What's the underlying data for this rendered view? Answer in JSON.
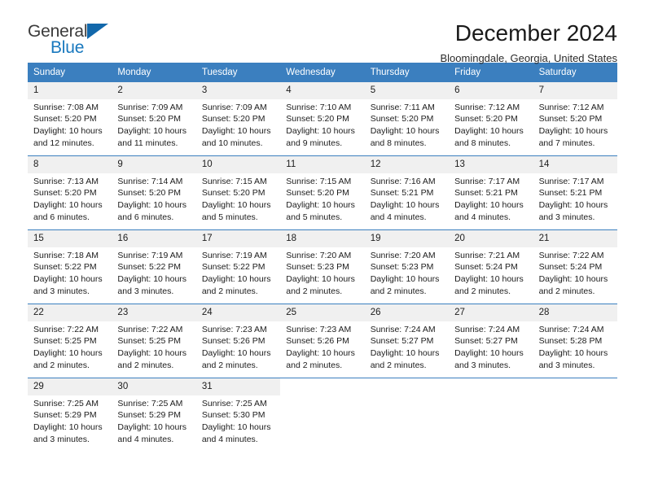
{
  "brand": {
    "name_part1": "General",
    "name_part2": "Blue",
    "triangle_icon": "triangle-icon",
    "accent_color": "#1878be"
  },
  "header": {
    "title": "December 2024",
    "location": "Bloomingdale, Georgia, United States"
  },
  "calendar": {
    "header_color": "#3b7fbf",
    "weekdays": [
      "Sunday",
      "Monday",
      "Tuesday",
      "Wednesday",
      "Thursday",
      "Friday",
      "Saturday"
    ],
    "weeks": [
      [
        {
          "day": "1",
          "sunrise": "Sunrise: 7:08 AM",
          "sunset": "Sunset: 5:20 PM",
          "daylight": "Daylight: 10 hours and 12 minutes."
        },
        {
          "day": "2",
          "sunrise": "Sunrise: 7:09 AM",
          "sunset": "Sunset: 5:20 PM",
          "daylight": "Daylight: 10 hours and 11 minutes."
        },
        {
          "day": "3",
          "sunrise": "Sunrise: 7:09 AM",
          "sunset": "Sunset: 5:20 PM",
          "daylight": "Daylight: 10 hours and 10 minutes."
        },
        {
          "day": "4",
          "sunrise": "Sunrise: 7:10 AM",
          "sunset": "Sunset: 5:20 PM",
          "daylight": "Daylight: 10 hours and 9 minutes."
        },
        {
          "day": "5",
          "sunrise": "Sunrise: 7:11 AM",
          "sunset": "Sunset: 5:20 PM",
          "daylight": "Daylight: 10 hours and 8 minutes."
        },
        {
          "day": "6",
          "sunrise": "Sunrise: 7:12 AM",
          "sunset": "Sunset: 5:20 PM",
          "daylight": "Daylight: 10 hours and 8 minutes."
        },
        {
          "day": "7",
          "sunrise": "Sunrise: 7:12 AM",
          "sunset": "Sunset: 5:20 PM",
          "daylight": "Daylight: 10 hours and 7 minutes."
        }
      ],
      [
        {
          "day": "8",
          "sunrise": "Sunrise: 7:13 AM",
          "sunset": "Sunset: 5:20 PM",
          "daylight": "Daylight: 10 hours and 6 minutes."
        },
        {
          "day": "9",
          "sunrise": "Sunrise: 7:14 AM",
          "sunset": "Sunset: 5:20 PM",
          "daylight": "Daylight: 10 hours and 6 minutes."
        },
        {
          "day": "10",
          "sunrise": "Sunrise: 7:15 AM",
          "sunset": "Sunset: 5:20 PM",
          "daylight": "Daylight: 10 hours and 5 minutes."
        },
        {
          "day": "11",
          "sunrise": "Sunrise: 7:15 AM",
          "sunset": "Sunset: 5:20 PM",
          "daylight": "Daylight: 10 hours and 5 minutes."
        },
        {
          "day": "12",
          "sunrise": "Sunrise: 7:16 AM",
          "sunset": "Sunset: 5:21 PM",
          "daylight": "Daylight: 10 hours and 4 minutes."
        },
        {
          "day": "13",
          "sunrise": "Sunrise: 7:17 AM",
          "sunset": "Sunset: 5:21 PM",
          "daylight": "Daylight: 10 hours and 4 minutes."
        },
        {
          "day": "14",
          "sunrise": "Sunrise: 7:17 AM",
          "sunset": "Sunset: 5:21 PM",
          "daylight": "Daylight: 10 hours and 3 minutes."
        }
      ],
      [
        {
          "day": "15",
          "sunrise": "Sunrise: 7:18 AM",
          "sunset": "Sunset: 5:22 PM",
          "daylight": "Daylight: 10 hours and 3 minutes."
        },
        {
          "day": "16",
          "sunrise": "Sunrise: 7:19 AM",
          "sunset": "Sunset: 5:22 PM",
          "daylight": "Daylight: 10 hours and 3 minutes."
        },
        {
          "day": "17",
          "sunrise": "Sunrise: 7:19 AM",
          "sunset": "Sunset: 5:22 PM",
          "daylight": "Daylight: 10 hours and 2 minutes."
        },
        {
          "day": "18",
          "sunrise": "Sunrise: 7:20 AM",
          "sunset": "Sunset: 5:23 PM",
          "daylight": "Daylight: 10 hours and 2 minutes."
        },
        {
          "day": "19",
          "sunrise": "Sunrise: 7:20 AM",
          "sunset": "Sunset: 5:23 PM",
          "daylight": "Daylight: 10 hours and 2 minutes."
        },
        {
          "day": "20",
          "sunrise": "Sunrise: 7:21 AM",
          "sunset": "Sunset: 5:24 PM",
          "daylight": "Daylight: 10 hours and 2 minutes."
        },
        {
          "day": "21",
          "sunrise": "Sunrise: 7:22 AM",
          "sunset": "Sunset: 5:24 PM",
          "daylight": "Daylight: 10 hours and 2 minutes."
        }
      ],
      [
        {
          "day": "22",
          "sunrise": "Sunrise: 7:22 AM",
          "sunset": "Sunset: 5:25 PM",
          "daylight": "Daylight: 10 hours and 2 minutes."
        },
        {
          "day": "23",
          "sunrise": "Sunrise: 7:22 AM",
          "sunset": "Sunset: 5:25 PM",
          "daylight": "Daylight: 10 hours and 2 minutes."
        },
        {
          "day": "24",
          "sunrise": "Sunrise: 7:23 AM",
          "sunset": "Sunset: 5:26 PM",
          "daylight": "Daylight: 10 hours and 2 minutes."
        },
        {
          "day": "25",
          "sunrise": "Sunrise: 7:23 AM",
          "sunset": "Sunset: 5:26 PM",
          "daylight": "Daylight: 10 hours and 2 minutes."
        },
        {
          "day": "26",
          "sunrise": "Sunrise: 7:24 AM",
          "sunset": "Sunset: 5:27 PM",
          "daylight": "Daylight: 10 hours and 2 minutes."
        },
        {
          "day": "27",
          "sunrise": "Sunrise: 7:24 AM",
          "sunset": "Sunset: 5:27 PM",
          "daylight": "Daylight: 10 hours and 3 minutes."
        },
        {
          "day": "28",
          "sunrise": "Sunrise: 7:24 AM",
          "sunset": "Sunset: 5:28 PM",
          "daylight": "Daylight: 10 hours and 3 minutes."
        }
      ],
      [
        {
          "day": "29",
          "sunrise": "Sunrise: 7:25 AM",
          "sunset": "Sunset: 5:29 PM",
          "daylight": "Daylight: 10 hours and 3 minutes."
        },
        {
          "day": "30",
          "sunrise": "Sunrise: 7:25 AM",
          "sunset": "Sunset: 5:29 PM",
          "daylight": "Daylight: 10 hours and 4 minutes."
        },
        {
          "day": "31",
          "sunrise": "Sunrise: 7:25 AM",
          "sunset": "Sunset: 5:30 PM",
          "daylight": "Daylight: 10 hours and 4 minutes."
        },
        {
          "day": "",
          "sunrise": "",
          "sunset": "",
          "daylight": ""
        },
        {
          "day": "",
          "sunrise": "",
          "sunset": "",
          "daylight": ""
        },
        {
          "day": "",
          "sunrise": "",
          "sunset": "",
          "daylight": ""
        },
        {
          "day": "",
          "sunrise": "",
          "sunset": "",
          "daylight": ""
        }
      ]
    ]
  }
}
